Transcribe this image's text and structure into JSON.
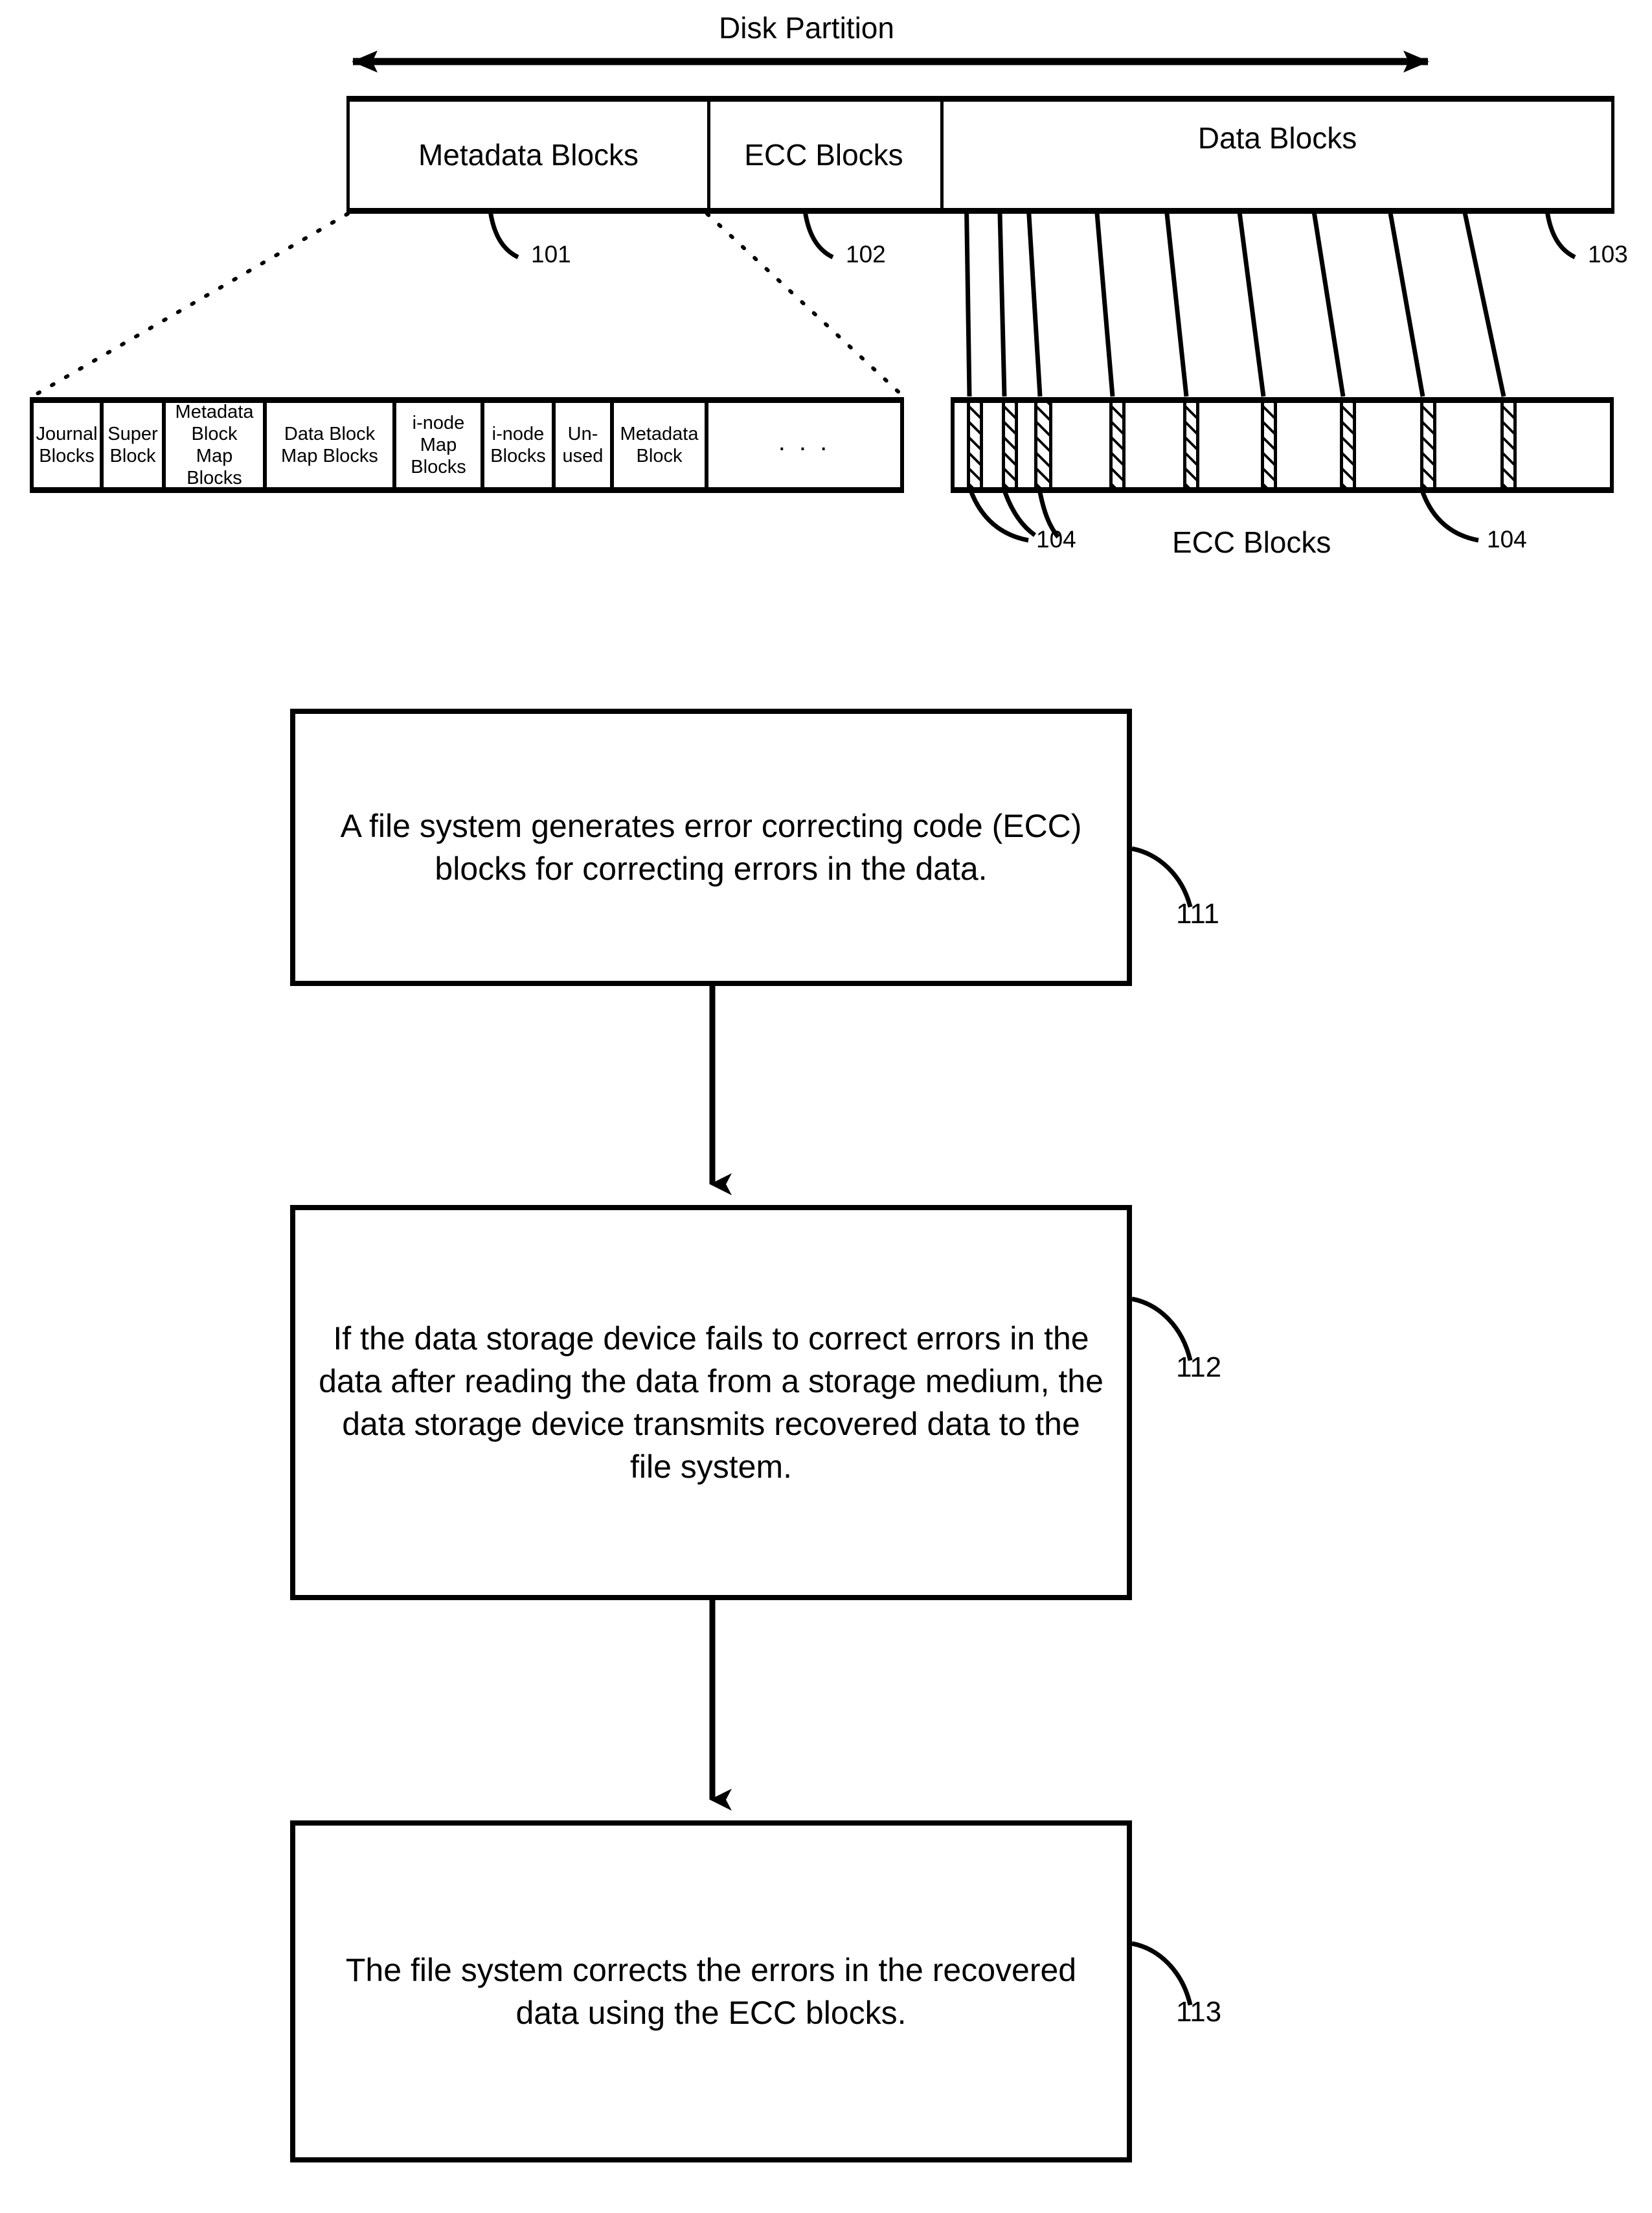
{
  "figure": {
    "top_diagram": {
      "span_label": "Disk Partition",
      "partition_segments": [
        {
          "label": "Metadata Blocks",
          "ref": "101"
        },
        {
          "label": "ECC Blocks",
          "ref": "102"
        },
        {
          "label": "Data Blocks",
          "ref": "103"
        }
      ],
      "metadata_detail_cells": [
        "Journal\nBlocks",
        "Super\nBlock",
        "Metadata\nBlock\nMap Blocks",
        "Data Block\nMap Blocks",
        "i-node\nMap\nBlocks",
        "i-node\nBlocks",
        "Un-\nused",
        "Metadata\nBlock",
        ". . ."
      ],
      "ecc_strip": {
        "caption": "ECC Blocks",
        "ref_left": "104",
        "ref_right": "104",
        "block_count": 9
      }
    },
    "flowchart": {
      "steps": [
        {
          "ref": "111",
          "text": "A file system generates error correcting code (ECC) blocks for correcting errors in the data."
        },
        {
          "ref": "112",
          "text": "If the data storage device fails to correct errors in the data after reading the data from a storage medium, the data storage device transmits recovered data to the file system."
        },
        {
          "ref": "113",
          "text": "The file system corrects the errors in the recovered data using the ECC blocks."
        }
      ]
    }
  },
  "colors": {
    "ink": "#000000",
    "paper": "#ffffff"
  }
}
